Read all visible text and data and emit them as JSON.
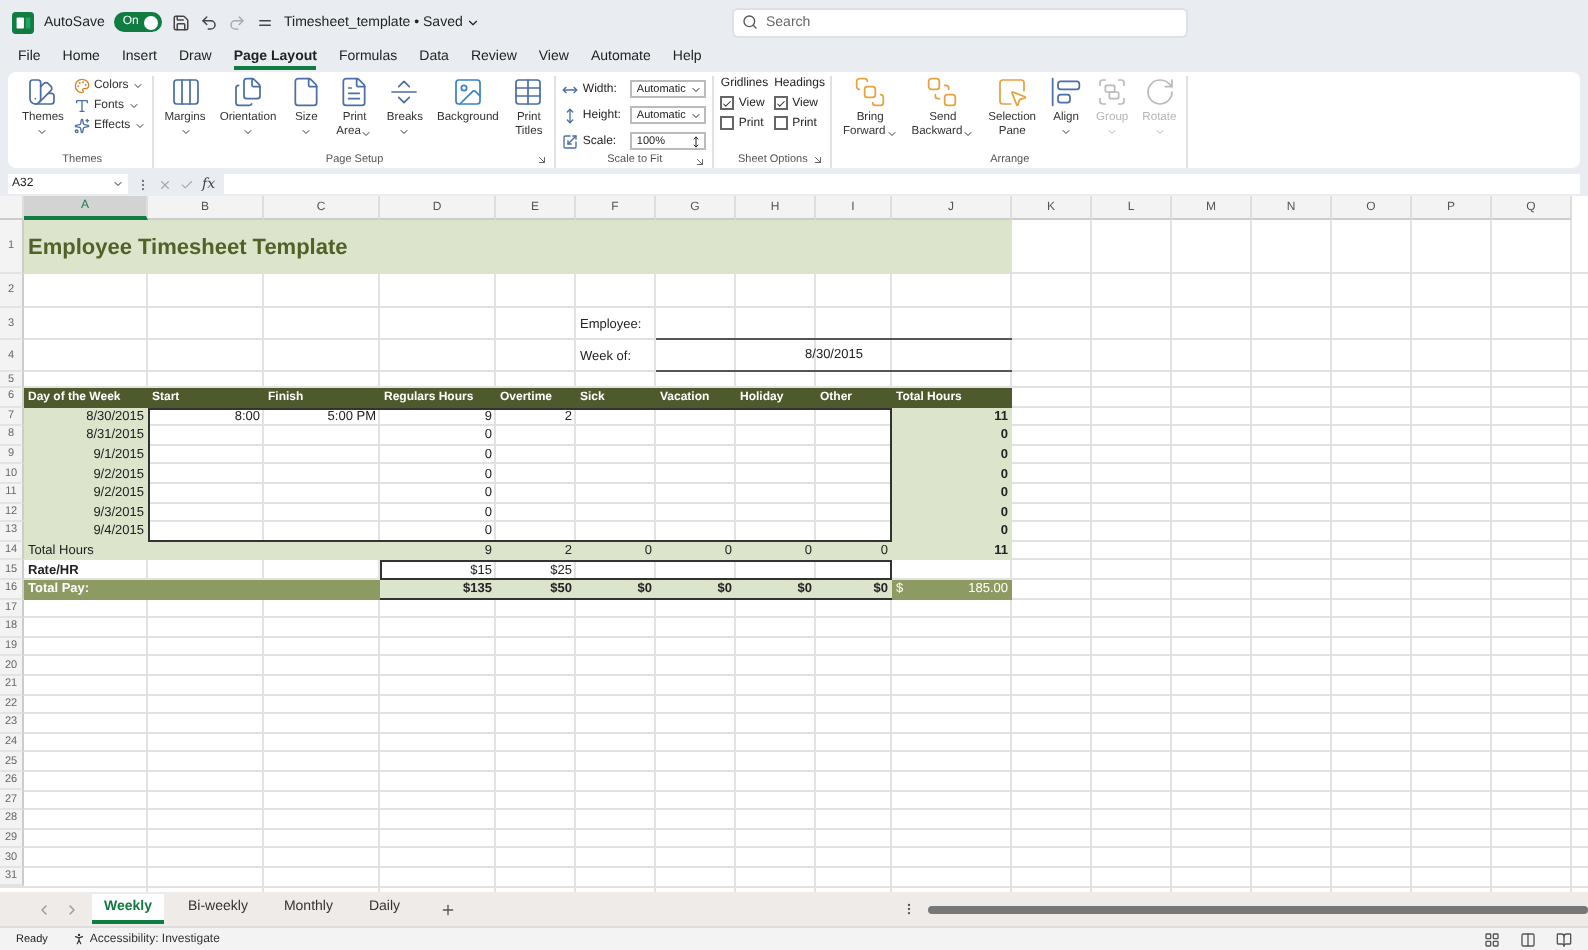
{
  "titlebar": {
    "autosave_label": "AutoSave",
    "autosave": {
      "label": "On",
      "on": true
    },
    "redo": {
      "disabled": true
    },
    "document": "Timesheet_template • Saved",
    "search": {
      "placeholder": "Search"
    }
  },
  "menu": [
    {
      "label": "File",
      "selected": false
    },
    {
      "label": "Home",
      "selected": false
    },
    {
      "label": "Insert",
      "selected": false
    },
    {
      "label": "Draw",
      "selected": false
    },
    {
      "label": "Page Layout",
      "selected": true
    },
    {
      "label": "Formulas",
      "selected": false
    },
    {
      "label": "Data",
      "selected": false
    },
    {
      "label": "Review",
      "selected": false
    },
    {
      "label": "View",
      "selected": false
    },
    {
      "label": "Automate",
      "selected": false
    },
    {
      "label": "Help",
      "selected": false
    }
  ],
  "ribbon": {
    "groups": [
      {
        "label": "Themes",
        "launcher": false,
        "items": [
          {
            "kind": "large",
            "lines": [
              "Themes"
            ],
            "menu": true
          },
          {
            "kind": "stack",
            "items": [
              {
                "label": "Colors",
                "menu": true
              },
              {
                "label": "Fonts",
                "menu": true
              },
              {
                "label": "Effects",
                "menu": true
              }
            ]
          }
        ]
      },
      {
        "label": "Page Setup",
        "launcher": true,
        "items": [
          {
            "kind": "large",
            "lines": [
              "Margins"
            ],
            "menu": true
          },
          {
            "kind": "large",
            "lines": [
              "Orientation"
            ],
            "menu": true
          },
          {
            "kind": "large",
            "lines": [
              "Size"
            ],
            "menu": true
          },
          {
            "kind": "large",
            "lines": [
              "Print",
              "Area"
            ],
            "menu": true
          },
          {
            "kind": "large",
            "lines": [
              "Breaks"
            ],
            "menu": true
          },
          {
            "kind": "large",
            "lines": [
              "Background"
            ],
            "menu": false
          },
          {
            "kind": "large",
            "lines": [
              "Print",
              "Titles"
            ],
            "menu": false
          }
        ]
      },
      {
        "label": "Scale to Fit",
        "launcher": true,
        "items": [
          {
            "kind": "fields",
            "items": [
              {
                "kind": "dropdown",
                "label": "Width:",
                "value": "Automatic"
              },
              {
                "kind": "dropdown",
                "label": "Height:",
                "value": "Automatic"
              },
              {
                "kind": "spinner",
                "label": "Scale:",
                "value": "100%"
              }
            ]
          }
        ]
      },
      {
        "label": "Sheet Options",
        "launcher": true,
        "items": [
          {
            "kind": "checks",
            "title": "Gridlines",
            "items": [
              {
                "label": "View",
                "checked": true
              },
              {
                "label": "Print",
                "checked": false
              }
            ]
          },
          {
            "kind": "checks",
            "title": "Headings",
            "items": [
              {
                "label": "View",
                "checked": true
              },
              {
                "label": "Print",
                "checked": false
              }
            ]
          }
        ]
      },
      {
        "label": "Arrange",
        "launcher": false,
        "items": [
          {
            "kind": "large",
            "lines": [
              "Bring",
              "Forward"
            ],
            "menu": true,
            "disabled": false
          },
          {
            "kind": "large",
            "lines": [
              "Send",
              "Backward"
            ],
            "menu": true,
            "disabled": false
          },
          {
            "kind": "large",
            "lines": [
              "Selection",
              "Pane"
            ],
            "menu": false,
            "disabled": false
          },
          {
            "kind": "large",
            "lines": [
              "Align"
            ],
            "menu": true,
            "disabled": false
          },
          {
            "kind": "large",
            "lines": [
              "Group"
            ],
            "menu": true,
            "disabled": true
          },
          {
            "kind": "large",
            "lines": [
              "Rotate"
            ],
            "menu": true,
            "disabled": true
          }
        ]
      }
    ]
  },
  "formula_bar": {
    "name_box": "A32",
    "function_label": "fx"
  },
  "sheet": {
    "columns": [
      {
        "label": "A",
        "selected": true
      },
      {
        "label": "B",
        "selected": false
      },
      {
        "label": "C",
        "selected": false
      },
      {
        "label": "D",
        "selected": false
      },
      {
        "label": "E",
        "selected": false
      },
      {
        "label": "F",
        "selected": false
      },
      {
        "label": "G",
        "selected": false
      },
      {
        "label": "H",
        "selected": false
      },
      {
        "label": "I",
        "selected": false
      },
      {
        "label": "J",
        "selected": false
      },
      {
        "label": "K",
        "selected": false
      },
      {
        "label": "L",
        "selected": false
      },
      {
        "label": "M",
        "selected": false
      },
      {
        "label": "N",
        "selected": false
      },
      {
        "label": "O",
        "selected": false
      },
      {
        "label": "P",
        "selected": false
      },
      {
        "label": "Q",
        "selected": false
      }
    ],
    "row_numbers": [
      "1",
      "2",
      "3",
      "4",
      "5",
      "6",
      "7",
      "8",
      "9",
      "10",
      "11",
      "12",
      "13",
      "14",
      "15",
      "16",
      "17",
      "18",
      "19",
      "20",
      "21",
      "22",
      "23",
      "24",
      "25",
      "26",
      "27",
      "28",
      "29",
      "30",
      "31"
    ],
    "title": "Employee Timesheet Template",
    "fields": [
      {
        "label": "Employee:"
      },
      {
        "label": "Week of:",
        "value": "8/30/2015"
      }
    ],
    "table": {
      "columns": [
        "Day of the Week",
        "Start",
        "Finish",
        "Regulars Hours",
        "Overtime",
        "Sick",
        "Vacation",
        "Holiday",
        "Other",
        "Total Hours"
      ],
      "rows": [
        {
          "day": "8/30/2015",
          "start": "8:00",
          "finish": "5:00 PM",
          "regular": "9",
          "overtime": "2",
          "total": "11"
        },
        {
          "day": "8/31/2015",
          "regular": "0",
          "total": "0"
        },
        {
          "day": "9/1/2015",
          "regular": "0",
          "total": "0"
        },
        {
          "day": "9/2/2015",
          "regular": "0",
          "total": "0"
        },
        {
          "day": "9/2/2015",
          "regular": "0",
          "total": "0"
        },
        {
          "day": "9/3/2015",
          "regular": "0",
          "total": "0"
        },
        {
          "day": "9/4/2015",
          "regular": "0",
          "total": "0"
        }
      ],
      "totals": {
        "label": "Total Hours",
        "values": [
          "9",
          "2",
          "0",
          "0",
          "0",
          "0"
        ],
        "total": "11"
      },
      "rate": {
        "label": "Rate/HR",
        "values": [
          "$15",
          "$25"
        ]
      },
      "pay": {
        "label": "Total Pay:",
        "values": [
          "$135",
          "$50",
          "$0",
          "$0",
          "$0",
          "$0"
        ],
        "currency": "$",
        "total": "185.00"
      }
    }
  },
  "sheet_tabs": [
    {
      "label": "Weekly",
      "selected": true
    },
    {
      "label": "Bi-weekly",
      "selected": false
    },
    {
      "label": "Monthly",
      "selected": false
    },
    {
      "label": "Daily",
      "selected": false
    }
  ],
  "status_bar": {
    "ready": "Ready",
    "accessibility": "Accessibility: Investigate"
  }
}
